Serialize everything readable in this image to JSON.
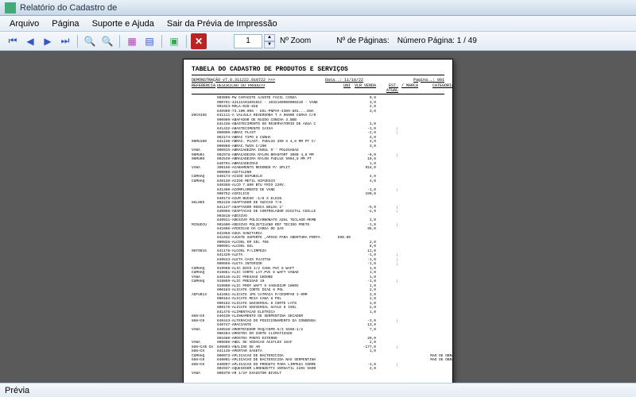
{
  "titlebar": {
    "text": "Relatório do Cadastro de"
  },
  "menu": {
    "arquivo": "Arquivo",
    "pagina": "Página",
    "suporte": "Suporte e Ajuda",
    "sair": "Sair da Prévia de Impressão"
  },
  "toolbar": {
    "zoom_value": "1",
    "zoom_label": "Nº Zoom",
    "pages_label": "Nº de Páginas:",
    "pages_info": "Número Página: 1 / 49"
  },
  "status": {
    "text": "Prévia"
  },
  "report": {
    "title": "TABELA DO CADASTRO DE PRODUTOS E SERVIÇOS",
    "demo": "DEMONSTRAÇÃO v7.0.311222.010722 >>>",
    "data": "Data..: 11/10/22",
    "pagina": "Pagina..: 001",
    "hdr": {
      "ref": "REFERENCIA",
      "desc": "DESCRICAO DO PRODUTO",
      "uni": "UNI",
      "vlr": "VLR VENDA",
      "est": "EST. ATUAL",
      "marca": "/ MARCA",
      "cat": "CATEGORIA"
    },
    "rows": [
      {
        "r": "",
        "d": "003905-PW CAPACETE AJUSTE FACIL CINZA",
        "vlr": "9,9"
      },
      {
        "r": "",
        "d": "000791-4211CA0189191C - 1032100000000310 - VANE",
        "vlr": "3,0"
      },
      {
        "r": "",
        "d": "001023-MOLA-028-828",
        "vlr": "2,0",
        "est": ""
      },
      {
        "r": "",
        "d": "840909-73.100.008 - EOL-PNPA#-4309-501....ENA",
        "vlr": "3,0"
      },
      {
        "r": "89C9198",
        "d": "841111-A VALVULA REVERSORA T A 05000 CURVA C/R"
      },
      {
        "r": "",
        "d": "000999-ABAFADOR DE RUIDO CONCHA 3.NDB"
      },
      {
        "r": "",
        "d": "841438-ABASTECIMENTO DO RESERVATORIO DE AGUA C",
        "vlr": "1,0"
      },
      {
        "r": "",
        "d": "841432-ABASTECIMENTO CAIXA",
        "vlr": "-1,0",
        "est": ";"
      },
      {
        "r": "",
        "d": "000090-ABRAC PLAST",
        "vlr": "-2,0",
        "est": ";"
      },
      {
        "r": "",
        "d": "002174-ABRAC TIPO U CUNHA",
        "vlr": "4,0"
      },
      {
        "r": "06MU100",
        "d": "841138-ABRAC. PLAST. FUELUX 200 X 4,8 MM PT C/",
        "vlr": "4,0"
      },
      {
        "r": "",
        "d": "000088-ABRAC.TWIN C/200",
        "vlr": "3,0"
      },
      {
        "r": "VANA",
        "d": "000915-ABRACADEIRA INSUL 9'' POLEGADAS"
      },
      {
        "r": "06MU01",
        "d": "002978-ABRACADEIRA NYLON BRASFORT 3000 4,8 MM",
        "vlr": "-6,0",
        "est": ";"
      },
      {
        "r": "06MU00",
        "d": "002549-ABRACADEIRA NYLON FUELUX 5004,8 MM PT",
        "vlr": "10,0"
      },
      {
        "r": "",
        "d": "840791-ABRACADEIRAS",
        "vlr": "1,0"
      },
      {
        "r": "VANA",
        "d": "390156-ACABAMENTO REDONDO P/ SPLIT",
        "vlr": "918,0"
      },
      {
        "r": "",
        "d": "000006-ACETILENO"
      },
      {
        "r": "CUMHAQ",
        "d": "840174-ACIDO BIFUBILO",
        "vlr": "4,0"
      },
      {
        "r": "CUMHAQ",
        "d": "840139-ACIDO METIL NIFURICO",
        "vlr": "4,0"
      },
      {
        "r": "",
        "d": "840368-ALCO 7.800 BTU FRIO 220V."
      },
      {
        "r": "",
        "d": "841400-ACOMPLAMENTO DE VANE",
        "vlr": "-1,0",
        "est": ";"
      },
      {
        "r": "",
        "d": "000752-ACRILICO",
        "vlr": "190,0"
      },
      {
        "r": "",
        "d": "840173-ACUM BUCHO -1/8 X ELGIN"
      },
      {
        "r": "86L085",
        "d": "002228-ADAPTADOR DE SUCCAO 7/8"
      },
      {
        "r": "",
        "d": "841147-ADAPTADOR ROSCA BOLDA 1\"",
        "vlr": "-5,0",
        "est": ";"
      },
      {
        "r": "",
        "d": "840958-ADAPTACAO DE CONTROLADOR DIGITAL CHILLE",
        "vlr": "-2,0",
        "est": ";"
      },
      {
        "r": "",
        "d": "003818-ADESIVO"
      },
      {
        "r": "",
        "d": "840911-ADESIVO POLICARBONATO AZUL TECLADO MEMB",
        "vlr": "1,0"
      },
      {
        "r": "MISUGCU",
        "d": "001600-ADESIVO POLIETILENO REF TECIDO PRETO",
        "vlr": "-1,0",
        "est": ";"
      },
      {
        "r": "",
        "d": "841096-AFERICAO DA CARGA DE GAS",
        "vlr": "85,0"
      },
      {
        "r": "",
        "d": "841058-AGUA SANITARIA"
      },
      {
        "r": "",
        "d": "841032-AJUSTE SUPORTE ,APOIO PARA ABERTURA PORTA",
        "uni": "690.00"
      },
      {
        "r": "",
        "d": "000826-ALCOOL EM GEL 70%",
        "vlr": "2,0"
      },
      {
        "r": "",
        "d": "000991-ALCOOL GEL",
        "vlr": "6,0"
      },
      {
        "r": "06T0015",
        "d": "841178-ALCOOL P/LIMPEZA",
        "vlr": "11,0"
      },
      {
        "r": "",
        "d": "841420-ALETA",
        "vlr": "-1,0",
        "est": ";"
      },
      {
        "r": "",
        "d": "840543-ALETA CASS FUJITSU",
        "vlr": "-1,0",
        "est": ";"
      },
      {
        "r": "",
        "d": "000056-ALETA INTERIOR",
        "vlr": "-1,0",
        "est": ";"
      },
      {
        "r": "CUMHAQ",
        "d": "019960-ALIC BICO 1/2 CANA PVC 6 WAFT",
        "vlr": "1,0"
      },
      {
        "r": "CUMHAQ",
        "d": "019861-ALIC CORTE LAT.PVC 6 WAFT VANAD",
        "vlr": "1,0"
      },
      {
        "r": "VANA",
        "d": "840146-ALIC PRESSAO GEDORE",
        "vlr": "1,0"
      },
      {
        "r": "CUMHAQ",
        "d": "019859-ALIC PRESSAO 10",
        "vlr": "-1,0",
        "est": ";"
      },
      {
        "r": "",
        "d": "019960-ALIC PROF WAFT 8 VANADIUM 1000V",
        "vlr": "1,0"
      },
      {
        "r": "",
        "d": "000183-ALICATE CORTE DIAG 6 POL",
        "vlr": "2,0"
      },
      {
        "r": "ADFU013",
        "d": "841051-ALICATE JPG CATRACA P/CRIMPAR 1-6MM",
        "vlr": "2,0"
      },
      {
        "r": "",
        "d": "000184-ALICATE MEIA CANA 8 POL",
        "vlr": "2,0"
      },
      {
        "r": "",
        "d": "000182-ALICATE UNIVERSAL 8 CORTE LAT%",
        "vlr": "1,0"
      },
      {
        "r": "",
        "d": "000176-ALICATE UNIVERSAL HAYLE 8 ISOL",
        "vlr": "2,0"
      },
      {
        "r": "",
        "d": "841475-ALIMENTACAO ELETRICA",
        "vlr": "1,0"
      },
      {
        "r": "886+C0",
        "d": "840430-ALINHAMENTO DE SERPENTINA  SECADOR",
        "vlr": ""
      },
      {
        "r": "886+C0",
        "d": "840443-ALTERACAO DO POSICIONAMENTO DA CONDENSA",
        "vlr": "-3,0",
        "est": ";"
      },
      {
        "r": "",
        "d": "840747-AMACIANTE",
        "vlr": "13,0"
      },
      {
        "r": "VANA",
        "d": "840540-AMORTECEDOR MAQ/COPR.5/4 5508-1/2",
        "vlr": "7,0"
      },
      {
        "r": "",
        "d": "000494-AMOSTRA EM CORTE CLIMATIZADO"
      },
      {
        "r": "",
        "d": "003480-AMOSTRA PONTO EXTERNO",
        "vlr": "29,0"
      },
      {
        "r": "VANA",
        "d": "000680-ANEL DE VEDACAO ACIFLEX 1SAF",
        "vlr": "2,0"
      },
      {
        "r": "886+CA$ CH",
        "d": "840803-ANALISE DE AR",
        "vlr": "-177,0",
        "est": ";"
      },
      {
        "r": "886+CH",
        "d": "841149-APERTAR GAXETA",
        "vlr": "1,0"
      },
      {
        "r": "CUMHAQ",
        "d": "000073-APLICACAO DE BACTERICIDA",
        "cat": "MAO DE OBRA"
      },
      {
        "r": "886+C0",
        "d": "840001-APLICACAO DE BACTERICIDA NAS SERPENTINA",
        "cat": "MAO DE OBRA"
      },
      {
        "r": "886+C0",
        "d": "840097-APLICACAO DO PRODUTO PARA LIMPEZA CORRE",
        "vlr": "-1,0",
        "est": ";"
      },
      {
        "r": "",
        "d": "002937-AQUECEDOR LORENZETTI VERSATIL 220V 5500",
        "vlr": "2,0"
      },
      {
        "r": "VANA",
        "d": "000370-AR 1/2# EXAUSTOR BIVOLT"
      }
    ]
  }
}
